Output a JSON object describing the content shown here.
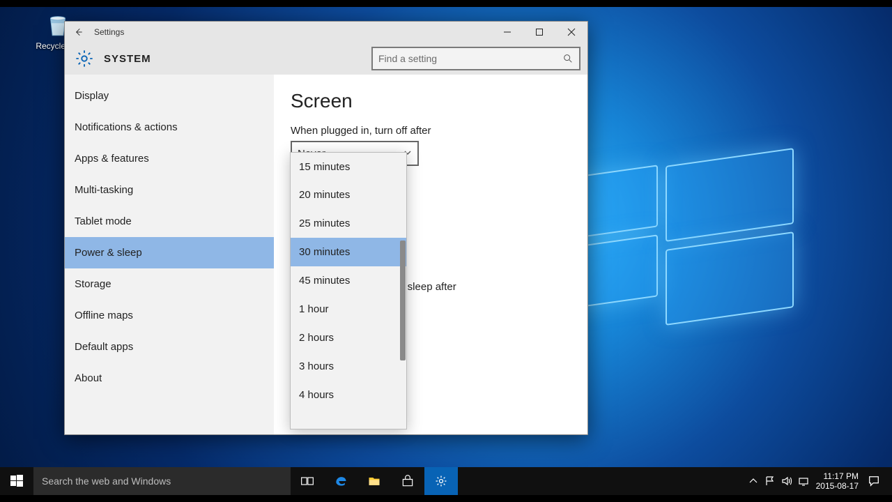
{
  "desktop": {
    "recycle_bin": "Recycle Bin"
  },
  "window": {
    "title": "Settings",
    "section": "SYSTEM",
    "search_placeholder": "Find a setting"
  },
  "sidebar": {
    "items": [
      {
        "label": "Display"
      },
      {
        "label": "Notifications & actions"
      },
      {
        "label": "Apps & features"
      },
      {
        "label": "Multi-tasking"
      },
      {
        "label": "Tablet mode"
      },
      {
        "label": "Power & sleep"
      },
      {
        "label": "Storage"
      },
      {
        "label": "Offline maps"
      },
      {
        "label": "Default apps"
      },
      {
        "label": "About"
      }
    ],
    "selected_index": 5
  },
  "content": {
    "heading": "Screen",
    "screen_label": "When plugged in, turn off after",
    "screen_value": "Never",
    "sleep_label_fragment": "to sleep after"
  },
  "dropdown": {
    "options": [
      {
        "label": "15 minutes"
      },
      {
        "label": "20 minutes"
      },
      {
        "label": "25 minutes"
      },
      {
        "label": "30 minutes"
      },
      {
        "label": "45 minutes"
      },
      {
        "label": "1 hour"
      },
      {
        "label": "2 hours"
      },
      {
        "label": "3 hours"
      },
      {
        "label": "4 hours"
      }
    ],
    "highlight_index": 3
  },
  "taskbar": {
    "search_placeholder": "Search the web and Windows",
    "clock_time": "11:17 PM",
    "clock_date": "2015-08-17"
  }
}
